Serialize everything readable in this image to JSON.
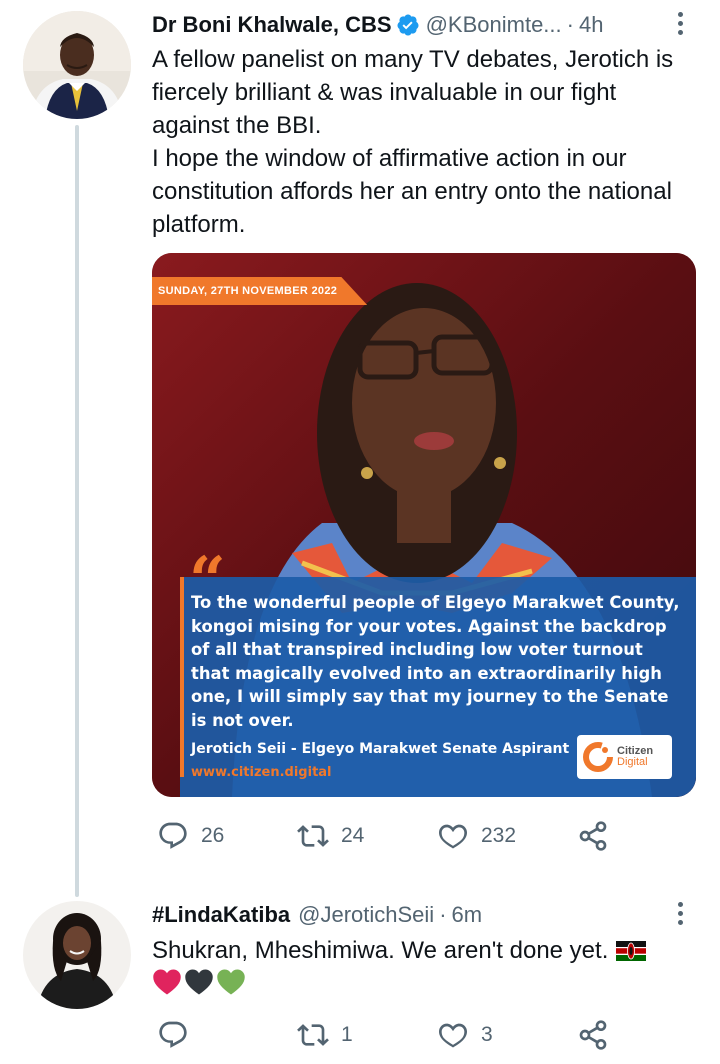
{
  "tweets": [
    {
      "author": "Dr Boni Khalwale, CBS",
      "handle": "@KBonimte...",
      "separator": "·",
      "time": "4h",
      "text": "A fellow panelist on many TV debates, Jerotich is fiercely brilliant & was invaluable in our fight against the BBI.\nI hope the window of affirmative action in our constitution affords her an entry onto the national platform.",
      "verified": true,
      "media": {
        "date_tag": "SUNDAY, 27TH NOVEMBER 2022",
        "quote": "To the wonderful people of Elgeyo Marakwet County, kongoi mising for your votes. Against the backdrop of all that transpired including low voter turnout that magically evolved into an extraordinarily high one, I will simply say that my journey to the Senate is not over.",
        "credit": "Jerotich Seii - Elgeyo Marakwet Senate Aspirant",
        "site": "www.citizen.digital",
        "logo_line1": "Citizen",
        "logo_line2": "Digital"
      },
      "replies": "26",
      "retweets": "24",
      "likes": "232"
    },
    {
      "author": "#LindaKatiba",
      "handle": "@JerotichSeii",
      "separator": "·",
      "time": "6m",
      "text": "Shukran, Mheshimiwa. We aren't done yet.",
      "hearts": [
        "red-heart",
        "black-heart",
        "green-heart"
      ],
      "replies": "",
      "retweets": "1",
      "likes": "3"
    }
  ],
  "icons": {
    "reply": "reply-icon",
    "retweet": "retweet-icon",
    "like": "like-icon",
    "share": "share-icon",
    "verified": "verified-badge-icon",
    "more": "more-options-icon",
    "flag": "kenya-flag-icon"
  },
  "colors": {
    "text": "#0f1419",
    "secondary": "#536471",
    "verified": "#1d9bf0",
    "thread_line": "#cfd9de",
    "brand_orange": "#f0782b"
  }
}
